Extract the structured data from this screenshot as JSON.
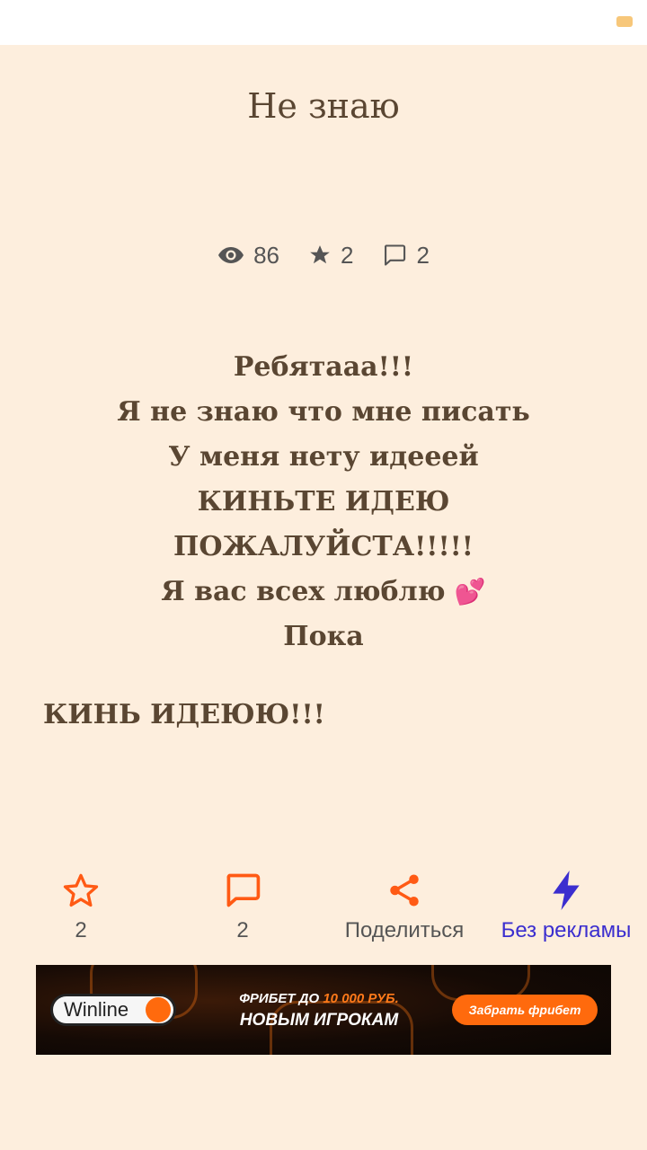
{
  "title": "Не знаю",
  "stats": {
    "views": "86",
    "stars": "2",
    "comments": "2"
  },
  "body": {
    "lines": [
      "Ребятааа!!!",
      "Я не знаю что мне писать",
      "У меня нету идееей",
      "КИНЬТЕ ИДЕЮ",
      "ПОЖАЛУЙСТА!!!!!",
      "Я вас всех люблю",
      "Пока"
    ],
    "heart_emoji": "💕",
    "final_line": "КИНЬ ИДЕЮЮ!!!"
  },
  "actions": {
    "star_count": "2",
    "comment_count": "2",
    "share_label": "Поделиться",
    "no_ads_label": "Без рекламы"
  },
  "banner": {
    "brand": "Winline",
    "promo_line1_prefix": "ФРИБЕТ ДО ",
    "promo_line1_highlight": "10 000 РУБ.",
    "promo_line2": "НОВЫМ ИГРОКАМ",
    "cta_label": "Забрать фрибет"
  },
  "colors": {
    "background": "#fdeedd",
    "text": "#5a4632",
    "accent_orange": "#ff5a14",
    "accent_purple": "#3b2ecf"
  }
}
